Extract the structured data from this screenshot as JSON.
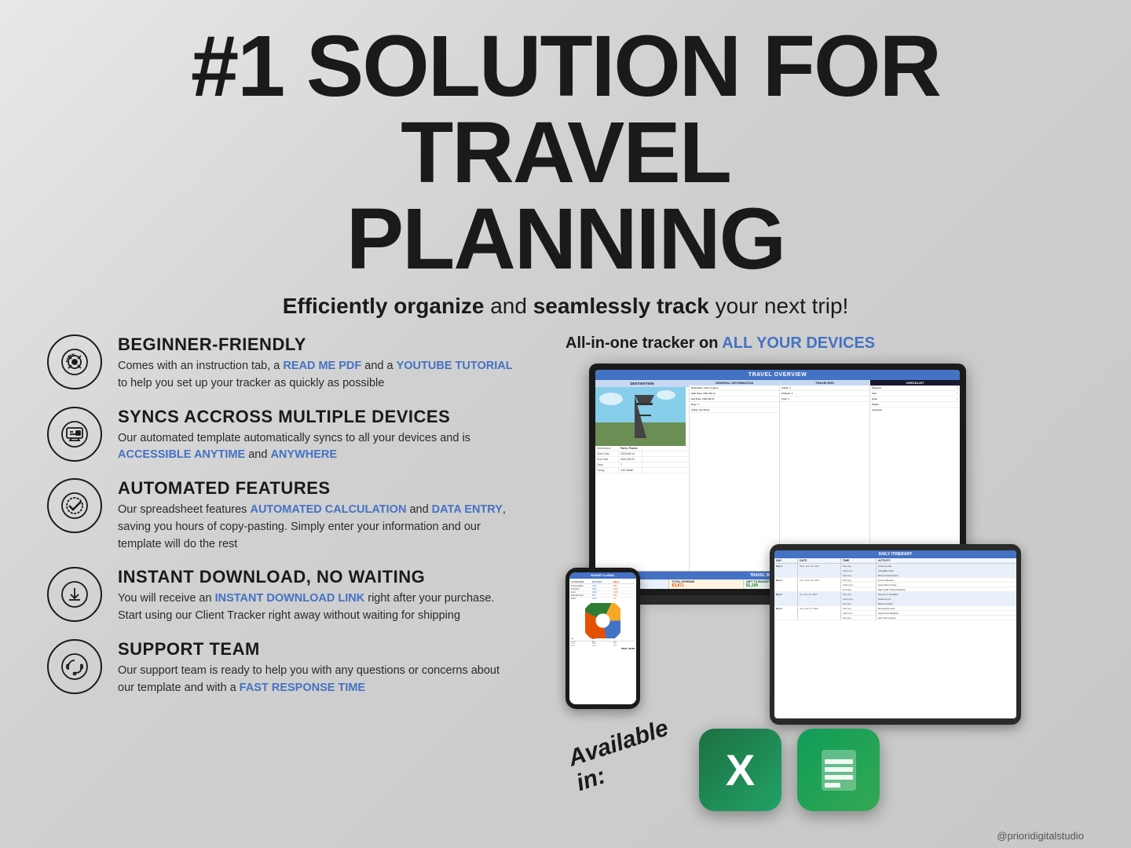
{
  "header": {
    "title_line1": "#1 SOLUTION FOR TRAVEL",
    "title_line2": "PLANNING",
    "subtitle_pre": "",
    "subtitle_bold1": "Efficiently organize",
    "subtitle_mid": " and ",
    "subtitle_bold2": "seamlessly track",
    "subtitle_post": " your next trip!"
  },
  "features": [
    {
      "id": "beginner-friendly",
      "icon": "🧩",
      "title": "BEGINNER-FRIENDLY",
      "desc_pre": "Comes with an instruction tab, a ",
      "highlight1": "READ ME PDF",
      "desc_mid": " and a ",
      "highlight2": "YOUTUBE TUTORIAL",
      "desc_post": " to help you set up your tracker as quickly as possible"
    },
    {
      "id": "syncs-devices",
      "icon": "🖥",
      "title": "SYNCS ACCROSS MULTIPLE DEVICES",
      "desc_pre": "Our automated template automatically syncs to all your devices and is ",
      "highlight1": "ACCESSIBLE ANYTIME",
      "desc_mid": " and ",
      "highlight2": "ANYWHERE",
      "desc_post": ""
    },
    {
      "id": "automated-features",
      "icon": "✓",
      "title": "AUTOMATED FEATURES",
      "desc_pre": "Our spreadsheet features ",
      "highlight1": "AUTOMATED CALCULATION",
      "desc_mid": " and ",
      "highlight2": "DATA ENTRY",
      "desc_post": ", saving you hours of copy-pasting. Simply enter your information and our template will do the rest"
    },
    {
      "id": "instant-download",
      "icon": "⬇",
      "title": "INSTANT DOWNLOAD, NO WAITING",
      "desc_pre": "You will receive an ",
      "highlight1": "INSTANT DOWNLOAD LINK",
      "desc_mid": " right after your purchase. Start using our Client Tracker right away without waiting for shipping",
      "highlight2": "",
      "desc_post": ""
    },
    {
      "id": "support-team",
      "icon": "🎧",
      "title": "SUPPORT TEAM",
      "desc_pre": "Our support team is ready to help you with any questions or concerns about our template and with a ",
      "highlight1": "FAST RESPONSE TIME",
      "desc_mid": "",
      "highlight2": "",
      "desc_post": ""
    }
  ],
  "devices_section": {
    "title_pre": "All-in-one tracker on ",
    "title_highlight": "ALL YOUR DEVICES"
  },
  "available_in": {
    "label": "Available in:",
    "apps": [
      "Excel",
      "Google Sheets"
    ]
  },
  "footer": {
    "handle": "@prioridigitalstudio"
  },
  "spreadsheet": {
    "main_title": "TRAVEL OVERVIEW",
    "budget_title": "TRAVEL BUDGET OVERVIEW",
    "itinerary_title": "DAILY ITINERARY"
  }
}
